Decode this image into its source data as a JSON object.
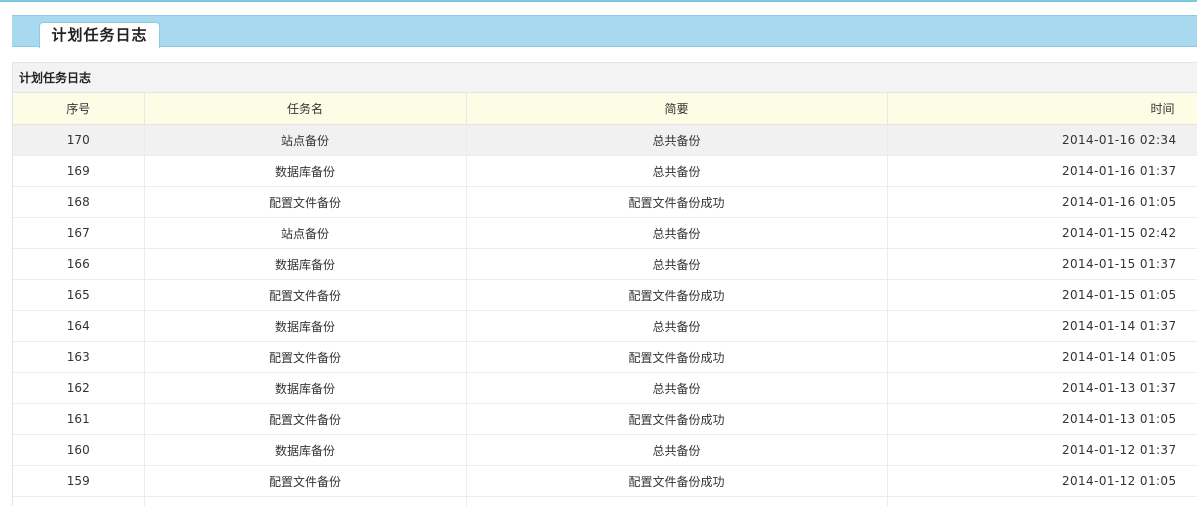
{
  "tab": {
    "label": "计划任务日志"
  },
  "panel": {
    "title": "计划任务日志"
  },
  "table": {
    "headers": {
      "id": "序号",
      "task_name": "任务名",
      "summary": "简要",
      "time": "时间"
    },
    "rows": [
      {
        "id": "170",
        "task_name": "站点备份",
        "summary": "总共备份",
        "time": "2014-01-16 02:34"
      },
      {
        "id": "169",
        "task_name": "数据库备份",
        "summary": "总共备份",
        "time": "2014-01-16 01:37"
      },
      {
        "id": "168",
        "task_name": "配置文件备份",
        "summary": "配置文件备份成功",
        "time": "2014-01-16 01:05"
      },
      {
        "id": "167",
        "task_name": "站点备份",
        "summary": "总共备份",
        "time": "2014-01-15 02:42"
      },
      {
        "id": "166",
        "task_name": "数据库备份",
        "summary": "总共备份",
        "time": "2014-01-15 01:37"
      },
      {
        "id": "165",
        "task_name": "配置文件备份",
        "summary": "配置文件备份成功",
        "time": "2014-01-15 01:05"
      },
      {
        "id": "164",
        "task_name": "数据库备份",
        "summary": "总共备份",
        "time": "2014-01-14 01:37"
      },
      {
        "id": "163",
        "task_name": "配置文件备份",
        "summary": "配置文件备份成功",
        "time": "2014-01-14 01:05"
      },
      {
        "id": "162",
        "task_name": "数据库备份",
        "summary": "总共备份",
        "time": "2014-01-13 01:37"
      },
      {
        "id": "161",
        "task_name": "配置文件备份",
        "summary": "配置文件备份成功",
        "time": "2014-01-13 01:05"
      },
      {
        "id": "160",
        "task_name": "数据库备份",
        "summary": "总共备份",
        "time": "2014-01-12 01:37"
      },
      {
        "id": "159",
        "task_name": "配置文件备份",
        "summary": "配置文件备份成功",
        "time": "2014-01-12 01:05"
      },
      {
        "id": "",
        "task_name": "",
        "summary": "",
        "time": ""
      }
    ]
  },
  "colors": {
    "tab_bar": "#a8d9ee",
    "header_row": "#fdfde6",
    "highlight_row": "#f1f1f1"
  }
}
